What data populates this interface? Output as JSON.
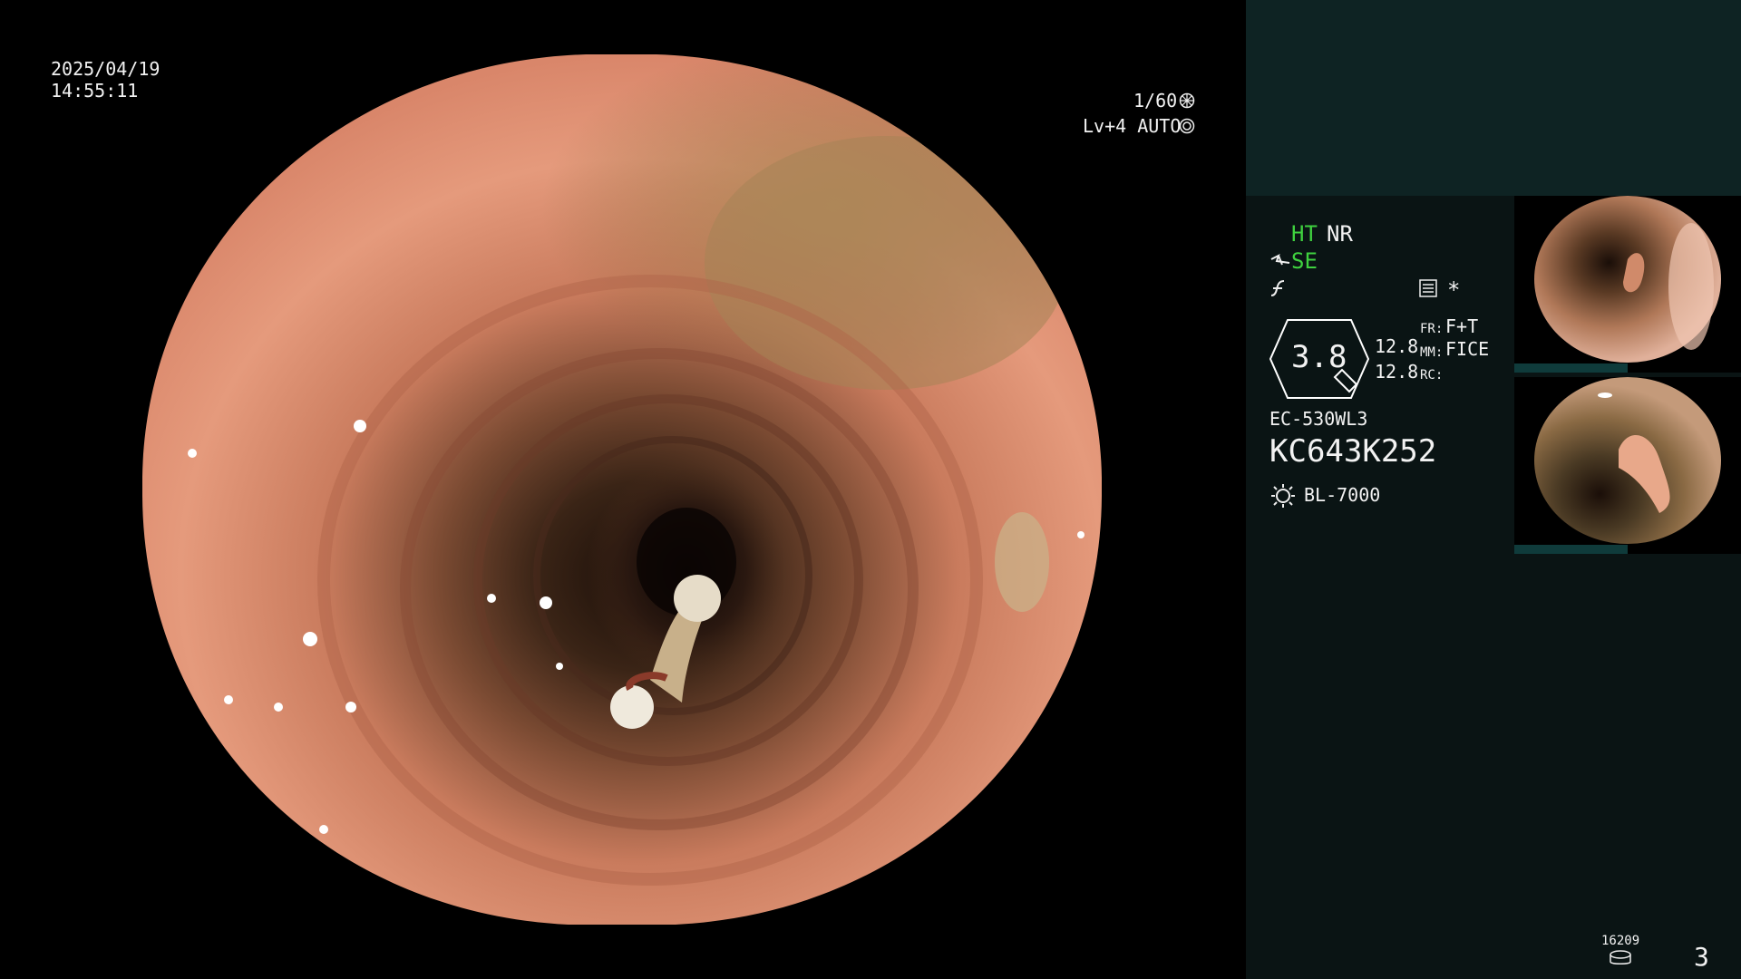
{
  "osd": {
    "date": "2025/04/19",
    "time": "14:55:11",
    "shutter": "1/60",
    "iris": "Lv+4 AUTO"
  },
  "panel": {
    "ht": "HT",
    "nr": "NR",
    "se": "SE",
    "asterisk": "*",
    "zoom_value": "3.8",
    "val1": "12.8",
    "val2": "12.8",
    "fr_label": "FR:",
    "fr_value": "F+T",
    "mm_label": "MM:",
    "mm_value": "FICE",
    "rc_label": "RC:",
    "scope_model": "EC-530WL3",
    "scope_serial": "KC643K252",
    "light_source": "BL-7000",
    "counter": "16209",
    "image_count": "3"
  },
  "colors": {
    "green": "#3fd13f",
    "panel_bg": "#0a1414",
    "panel_top_bg": "#0e2323"
  }
}
